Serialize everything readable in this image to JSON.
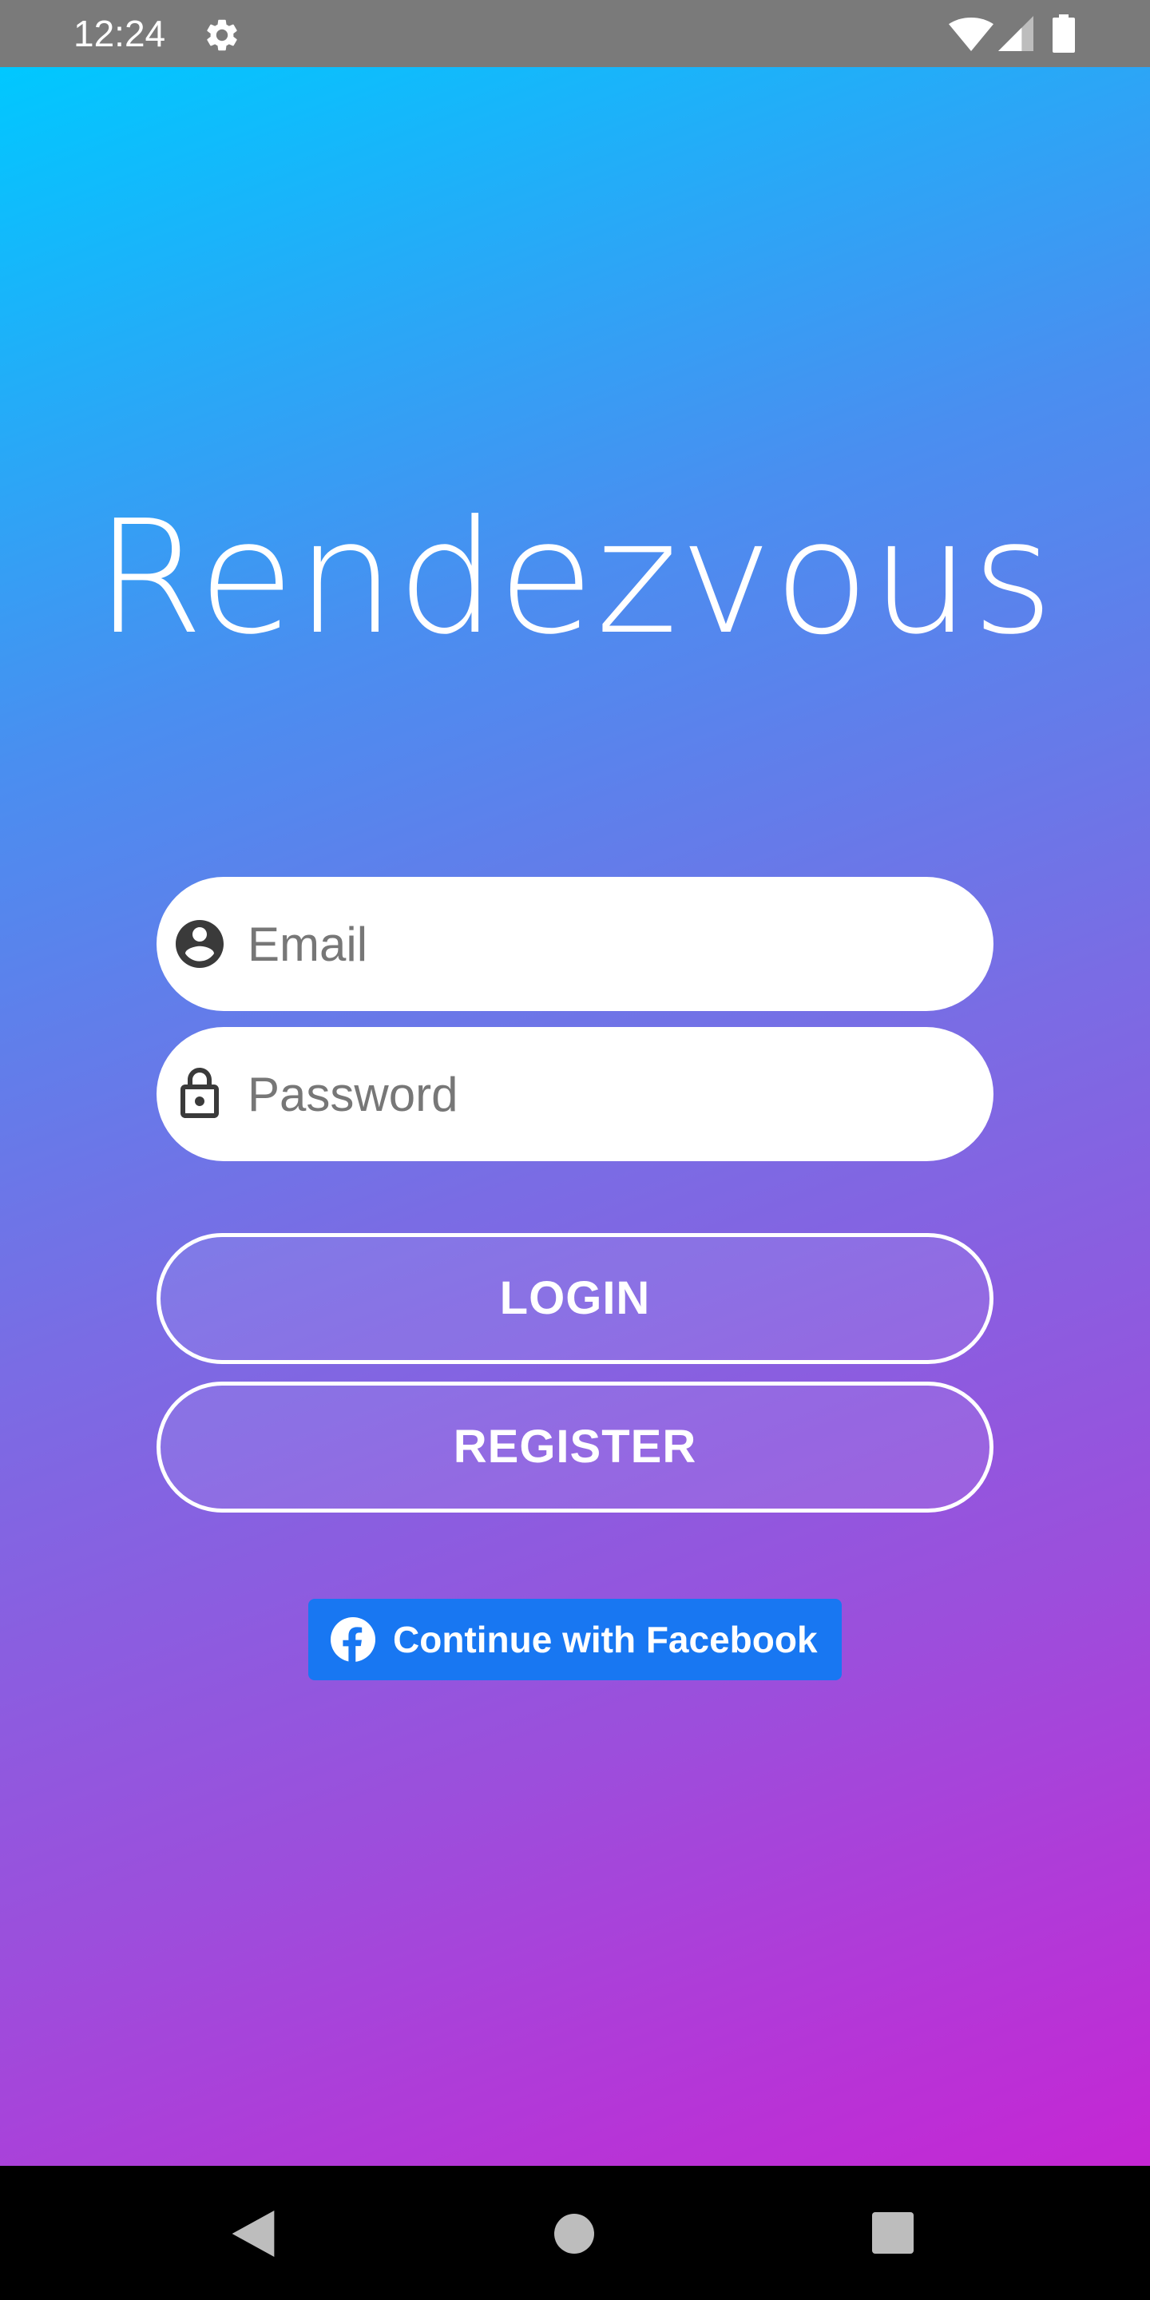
{
  "status_bar": {
    "time": "12:24",
    "icons": [
      "gear-icon",
      "wifi-icon",
      "signal-icon",
      "battery-icon"
    ]
  },
  "app": {
    "title": "Rendezvous"
  },
  "form": {
    "email": {
      "placeholder": "Email",
      "value": "",
      "icon": "account-circle-icon"
    },
    "password": {
      "placeholder": "Password",
      "value": "",
      "icon": "lock-icon"
    }
  },
  "buttons": {
    "login_label": "LOGIN",
    "register_label": "REGISTER",
    "facebook_label": "Continue with Facebook",
    "facebook_icon": "facebook-icon"
  },
  "nav_bar": {
    "icons": [
      "back-icon",
      "home-icon",
      "recents-icon"
    ]
  },
  "colors": {
    "gradient_start": "#00c8ff",
    "gradient_end": "#c526d4",
    "facebook_blue": "#1877f2",
    "status_bar": "#7a7a7a",
    "nav_bar": "#000000"
  }
}
